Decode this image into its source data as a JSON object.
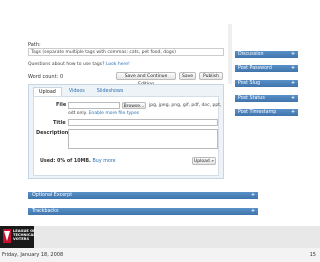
{
  "editor": {
    "path_label": "Path:",
    "tags_placeholder": "Tags (separate multiple tags with commas: cats, pet food, dogs)",
    "tags_help": "Questions about how to use tags?",
    "tags_help_link": "Look here!",
    "word_count": "Word count: 0",
    "save_continue_label": "Save and Continue Editing",
    "save_label": "Save",
    "publish_label": "Publish"
  },
  "upload": {
    "tabs": [
      "Upload",
      "Videos",
      "Slideshows"
    ],
    "file_label": "File",
    "browse_label": "Browse...",
    "file_hint": "jpg, jpeg, png, gif, pdf, doc, ppt,",
    "file_hint2": "odt only.",
    "enable_more_link": "Enable more file types",
    "title_label": "Title",
    "description_label": "Description",
    "used_text": "Used: 0% of 10MB.",
    "buy_more_link": "Buy more",
    "upload_button_label": "Upload »"
  },
  "panels": {
    "optional_excerpt": "Optional Excerpt",
    "trackbacks": "Trackbacks"
  },
  "sidebar": {
    "items": [
      "Discussion",
      "Post Password",
      "Post Slug",
      "Post Status",
      "Post Timestamp"
    ]
  },
  "footer": {
    "logo_lines": [
      "LEAGUE OF",
      "TECHNICAL",
      "VOTERS"
    ],
    "date": "Friday, January 18, 2008",
    "page": "15"
  },
  "colors": {
    "bar": "#3f74ad",
    "link": "#2a6fb5"
  }
}
